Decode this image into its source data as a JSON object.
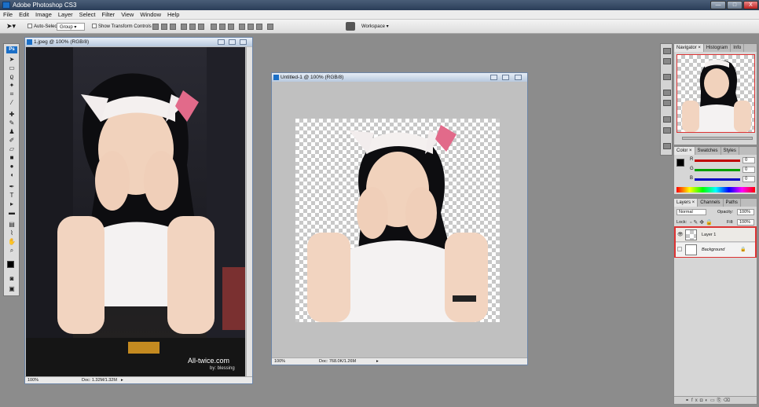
{
  "app": {
    "title": "Adobe Photoshop CS3"
  },
  "window_controls": {
    "minimize": "—",
    "maximize": "□",
    "close": "X"
  },
  "menu": [
    "File",
    "Edit",
    "Image",
    "Layer",
    "Select",
    "Filter",
    "View",
    "Window",
    "Help"
  ],
  "options_bar": {
    "auto_select_label": "Auto-Select:",
    "auto_select_value": "Group",
    "show_transform_label": "Show Transform Controls",
    "workspace_label": "Workspace ▾"
  },
  "toolbox": {
    "ps_label": "Ps"
  },
  "doc1": {
    "title": "1.jpeg @ 100% (RGB/8)",
    "zoom": "100%",
    "doc_info": "Doc: 1.32M/1.32M",
    "watermark": "All-twice.com",
    "watermark_sub": "by: blessing"
  },
  "doc2": {
    "title": "Untitled-1 @ 100% (RGB/8)",
    "zoom": "100%",
    "doc_info": "Doc: 768.0K/1.26M"
  },
  "navigator": {
    "tabs": [
      "Navigator ×",
      "Histogram",
      "Info"
    ]
  },
  "color_panel": {
    "tabs": [
      "Color ×",
      "Swatches",
      "Styles"
    ],
    "channels": [
      {
        "label": "R",
        "value": "0",
        "color": "#c00000"
      },
      {
        "label": "G",
        "value": "0",
        "color": "#00a000"
      },
      {
        "label": "B",
        "value": "0",
        "color": "#0000c0"
      }
    ]
  },
  "layers_panel": {
    "tabs": [
      "Layers ×",
      "Channels",
      "Paths"
    ],
    "blend_mode": "Normal",
    "opacity_label": "Opacity:",
    "opacity_value": "100%",
    "lock_label": "Lock:",
    "fill_label": "Fill:",
    "fill_value": "100%",
    "layers": [
      {
        "name": "Layer 1"
      },
      {
        "name": "Background"
      }
    ]
  }
}
